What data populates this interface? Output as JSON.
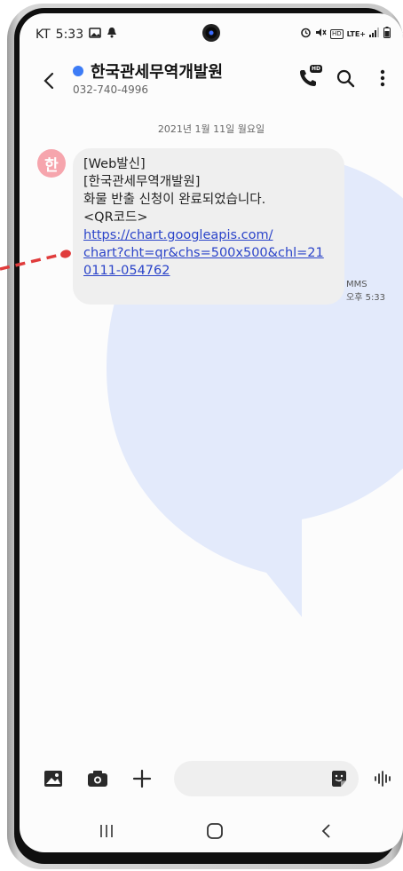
{
  "status_bar": {
    "carrier": "KT",
    "time": "5:33",
    "hd_label": "HD",
    "lte_label": "LTE+"
  },
  "header": {
    "contact_name": "한국관세무역개발원",
    "phone_number": "032-740-4996",
    "hd_badge": "HD",
    "accent_color": "#3d7cf6"
  },
  "conversation": {
    "date_separator": "2021년 1월 11일 월요일",
    "avatar_initial": "한",
    "avatar_color": "#f6a5ad",
    "message": {
      "lines": [
        "[Web발신]",
        "[한국관세무역개발원]",
        "화물 반출 신청이 완료되었습니다.",
        "<QR코드>"
      ],
      "link_lines": [
        "https://chart.googleapis.com/",
        "chart?cht=qr&chs=500x500&chl=21",
        "0111-054762"
      ],
      "type_label": "MMS",
      "time": "오후 5:33"
    }
  },
  "composer": {
    "placeholder": "",
    "icons": [
      "gallery-icon",
      "camera-icon",
      "plus-icon",
      "sticker-icon",
      "voice-icon"
    ]
  },
  "navigation": {
    "icons": [
      "recent-apps-icon",
      "home-icon",
      "back-icon"
    ]
  },
  "colors": {
    "link": "#2b44c9",
    "annotation_arrow": "#e03c3c",
    "bubble_bg": "#efefef",
    "watermark": "#e3eafb"
  }
}
